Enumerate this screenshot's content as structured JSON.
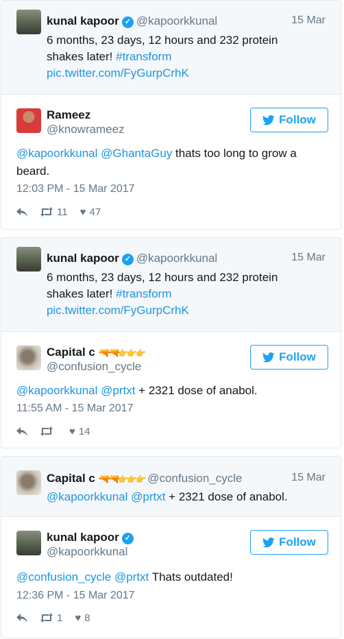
{
  "tweets": [
    {
      "quoted": {
        "name": "kunal kapoor",
        "handle": "@kapoorkkunal",
        "date": "15 Mar",
        "text_line1": "6 months, 23 days, 12 hours and 232 protein",
        "text_line2_plain": "shakes later! ",
        "hashtag": "#transform",
        "pic_link": "pic.twitter.com/FyGurpCrhK"
      },
      "reply": {
        "name": "Rameez",
        "handle": "@knowrameez",
        "follow_label": "Follow",
        "mention1": "@kapoorkkunal",
        "mention2": "@GhantaGuy",
        "text_rest": " thats too long to grow a",
        "text_line2": "beard.",
        "timestamp": "12:03 PM - 15 Mar 2017",
        "retweets": "11",
        "likes": "47"
      }
    },
    {
      "quoted": {
        "name": "kunal kapoor",
        "handle": "@kapoorkkunal",
        "date": "15 Mar",
        "text_line1": "6 months, 23 days, 12 hours and 232 protein",
        "text_line2_plain": "shakes later! ",
        "hashtag": "#transform",
        "pic_link": "pic.twitter.com/FyGurpCrhK"
      },
      "reply": {
        "name": "Capital c",
        "handle": "@confusion_cycle",
        "follow_label": "Follow",
        "mention1": "@kapoorkkunal",
        "mention2": "@prtxt",
        "text_rest": " + 2321 dose of anabol.",
        "timestamp": "11:55 AM - 15 Mar 2017",
        "retweets": "",
        "likes": "14"
      }
    },
    {
      "quoted": {
        "name": "Capital c",
        "handle": "@confusion_cycle",
        "date": "15 Mar",
        "mention1": "@kapoorkkunal",
        "mention2": "@prtxt",
        "text_rest": " + 2321 dose of anabol."
      },
      "reply": {
        "name": "kunal kapoor",
        "handle": "@kapoorkkunal",
        "follow_label": "Follow",
        "mention1": "@confusion_cycle",
        "mention2": "@prtxt",
        "text_rest": " Thats outdated!",
        "timestamp": "12:36 PM - 15 Mar 2017",
        "retweets": "1",
        "likes": "8"
      }
    }
  ],
  "icons": {
    "verified": "verified-badge-icon",
    "reply": "reply-icon",
    "retweet": "retweet-icon",
    "like": "heart-icon",
    "bird": "twitter-bird-icon"
  },
  "colors": {
    "link": "#1b95e0",
    "accent": "#1da1f2",
    "muted": "#657786",
    "quoted_bg": "#f5f8fa"
  }
}
